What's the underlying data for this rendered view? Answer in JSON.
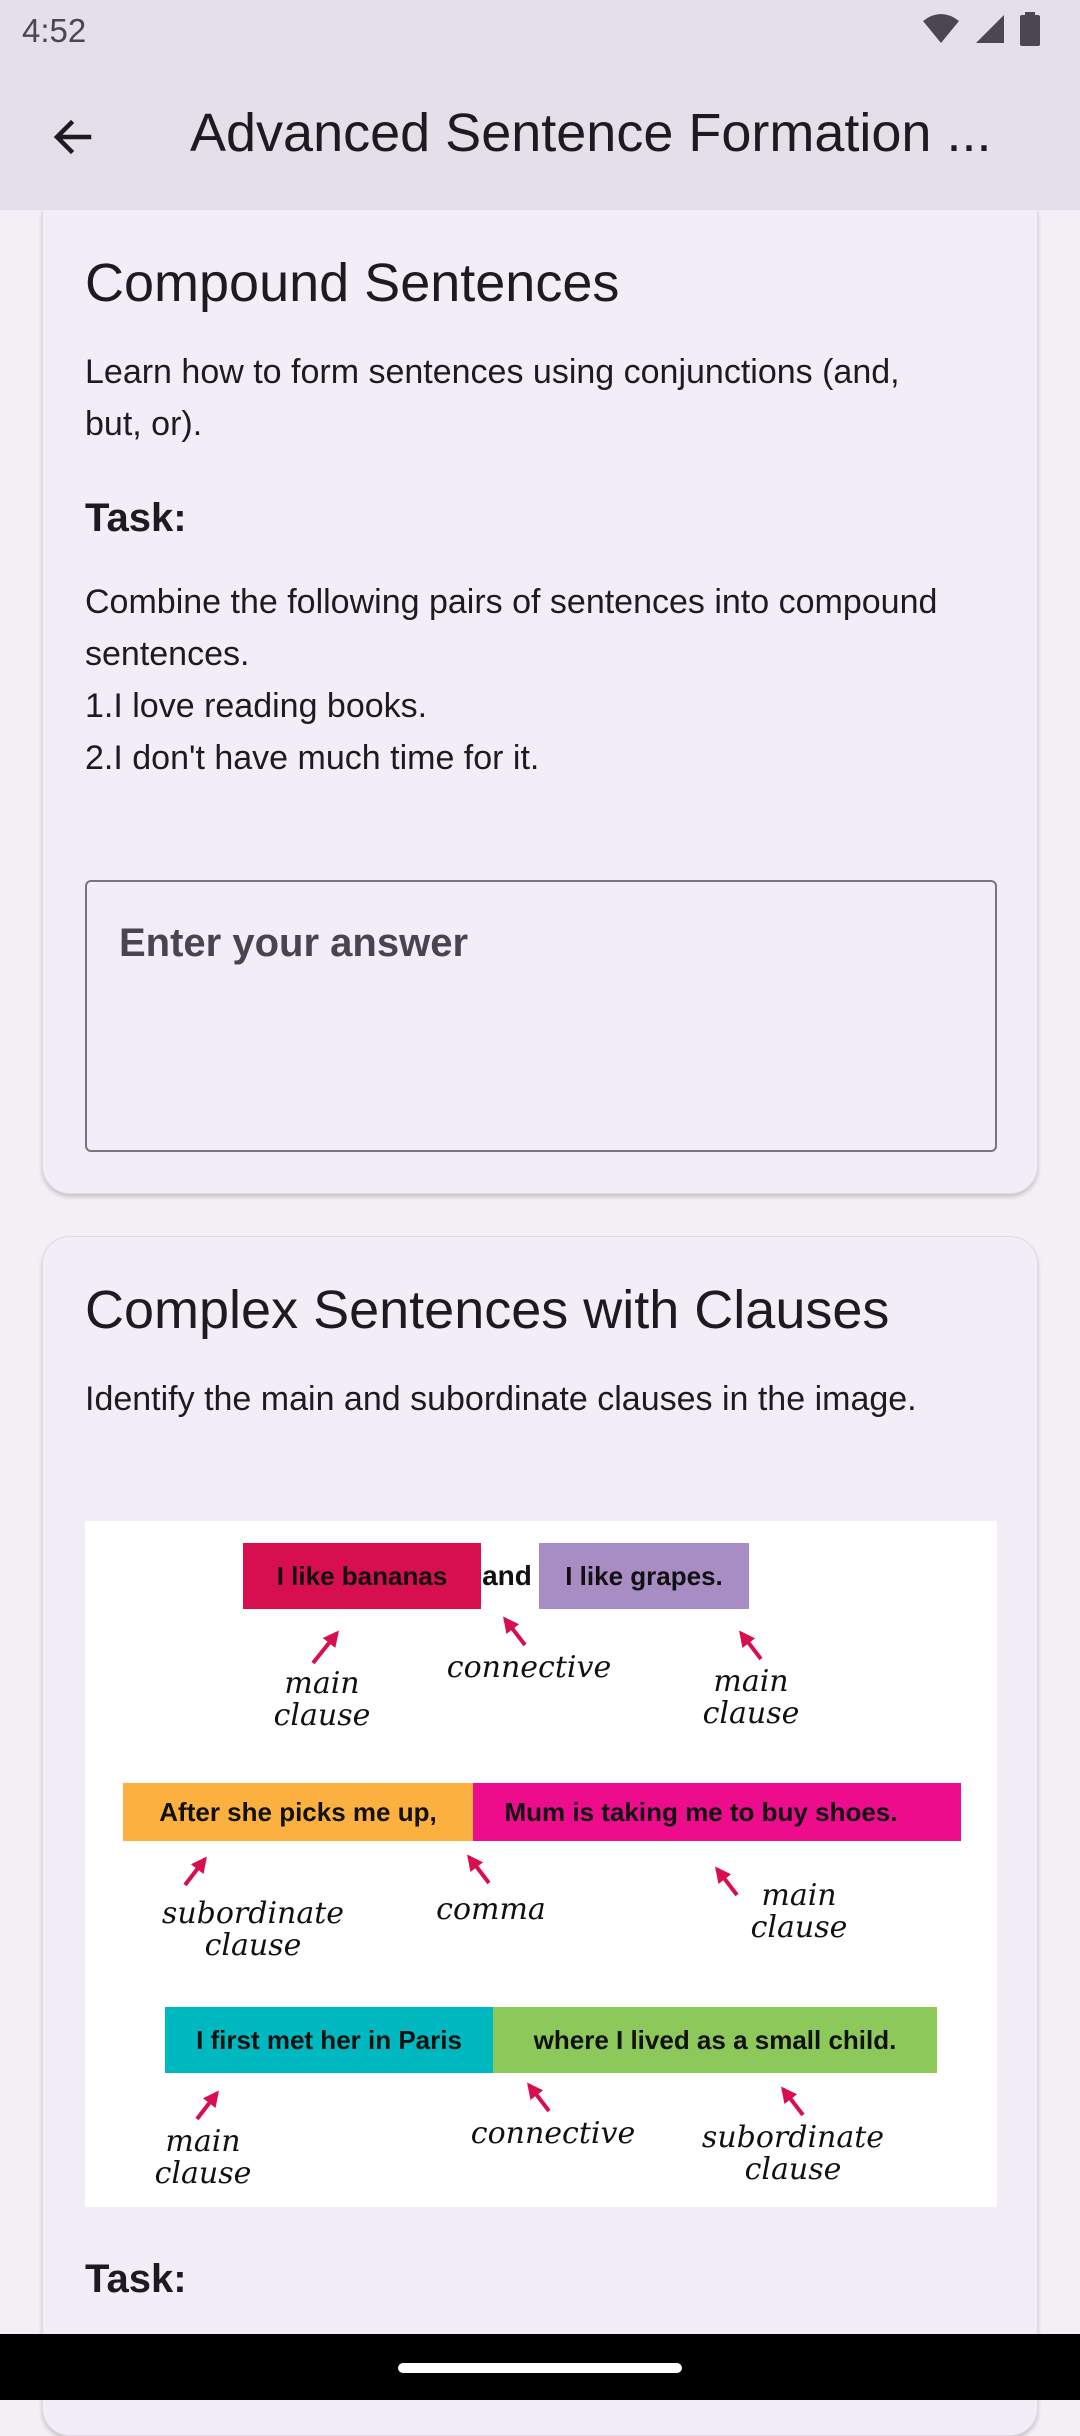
{
  "status_bar": {
    "time": "4:52"
  },
  "appbar": {
    "title": "Advanced Sentence Formation ..."
  },
  "card_compound": {
    "title": "Compound Sentences",
    "description": "Learn how to form sentences using conjunctions (and, but, or).",
    "task_label": "Task:",
    "task_text": "Combine the following pairs of sentences into compound sentences.",
    "sentence_1": "1.I love reading books.",
    "sentence_2": "2.I don't have much time for it.",
    "answer_placeholder": "Enter your answer",
    "answer_value": ""
  },
  "card_complex": {
    "title": "Complex Sentences with Clauses",
    "description": "Identify the main and subordinate clauses in the image.",
    "task_label": "Task:",
    "image": {
      "row1": {
        "box_a": "I like bananas",
        "connector": "and",
        "box_b": "I like grapes.",
        "label_left": [
          "main",
          "clause"
        ],
        "label_mid": "connective",
        "label_right": [
          "main",
          "clause"
        ]
      },
      "row2": {
        "box_a": "After she picks me up,",
        "box_b": "Mum is taking me to buy shoes.",
        "label_left": [
          "subordinate",
          "clause"
        ],
        "label_mid": "comma",
        "label_right": [
          "main",
          "clause"
        ]
      },
      "row3": {
        "box_a": "I first met her in Paris",
        "box_b": "where I lived as a small child.",
        "label_left": [
          "main",
          "clause"
        ],
        "label_mid": "connective",
        "label_right": [
          "subordinate",
          "clause"
        ]
      }
    }
  },
  "colors": {
    "appbar_bg": "#E4E0EA",
    "card_bg": "#F3EDF7",
    "box_red": "#D80F4F",
    "box_purple": "#A88CC4",
    "box_orange": "#FBB040",
    "box_pink": "#EC0C8C",
    "box_teal": "#00B8C0",
    "box_green": "#8CC85A",
    "arrow": "#D80F4F"
  }
}
